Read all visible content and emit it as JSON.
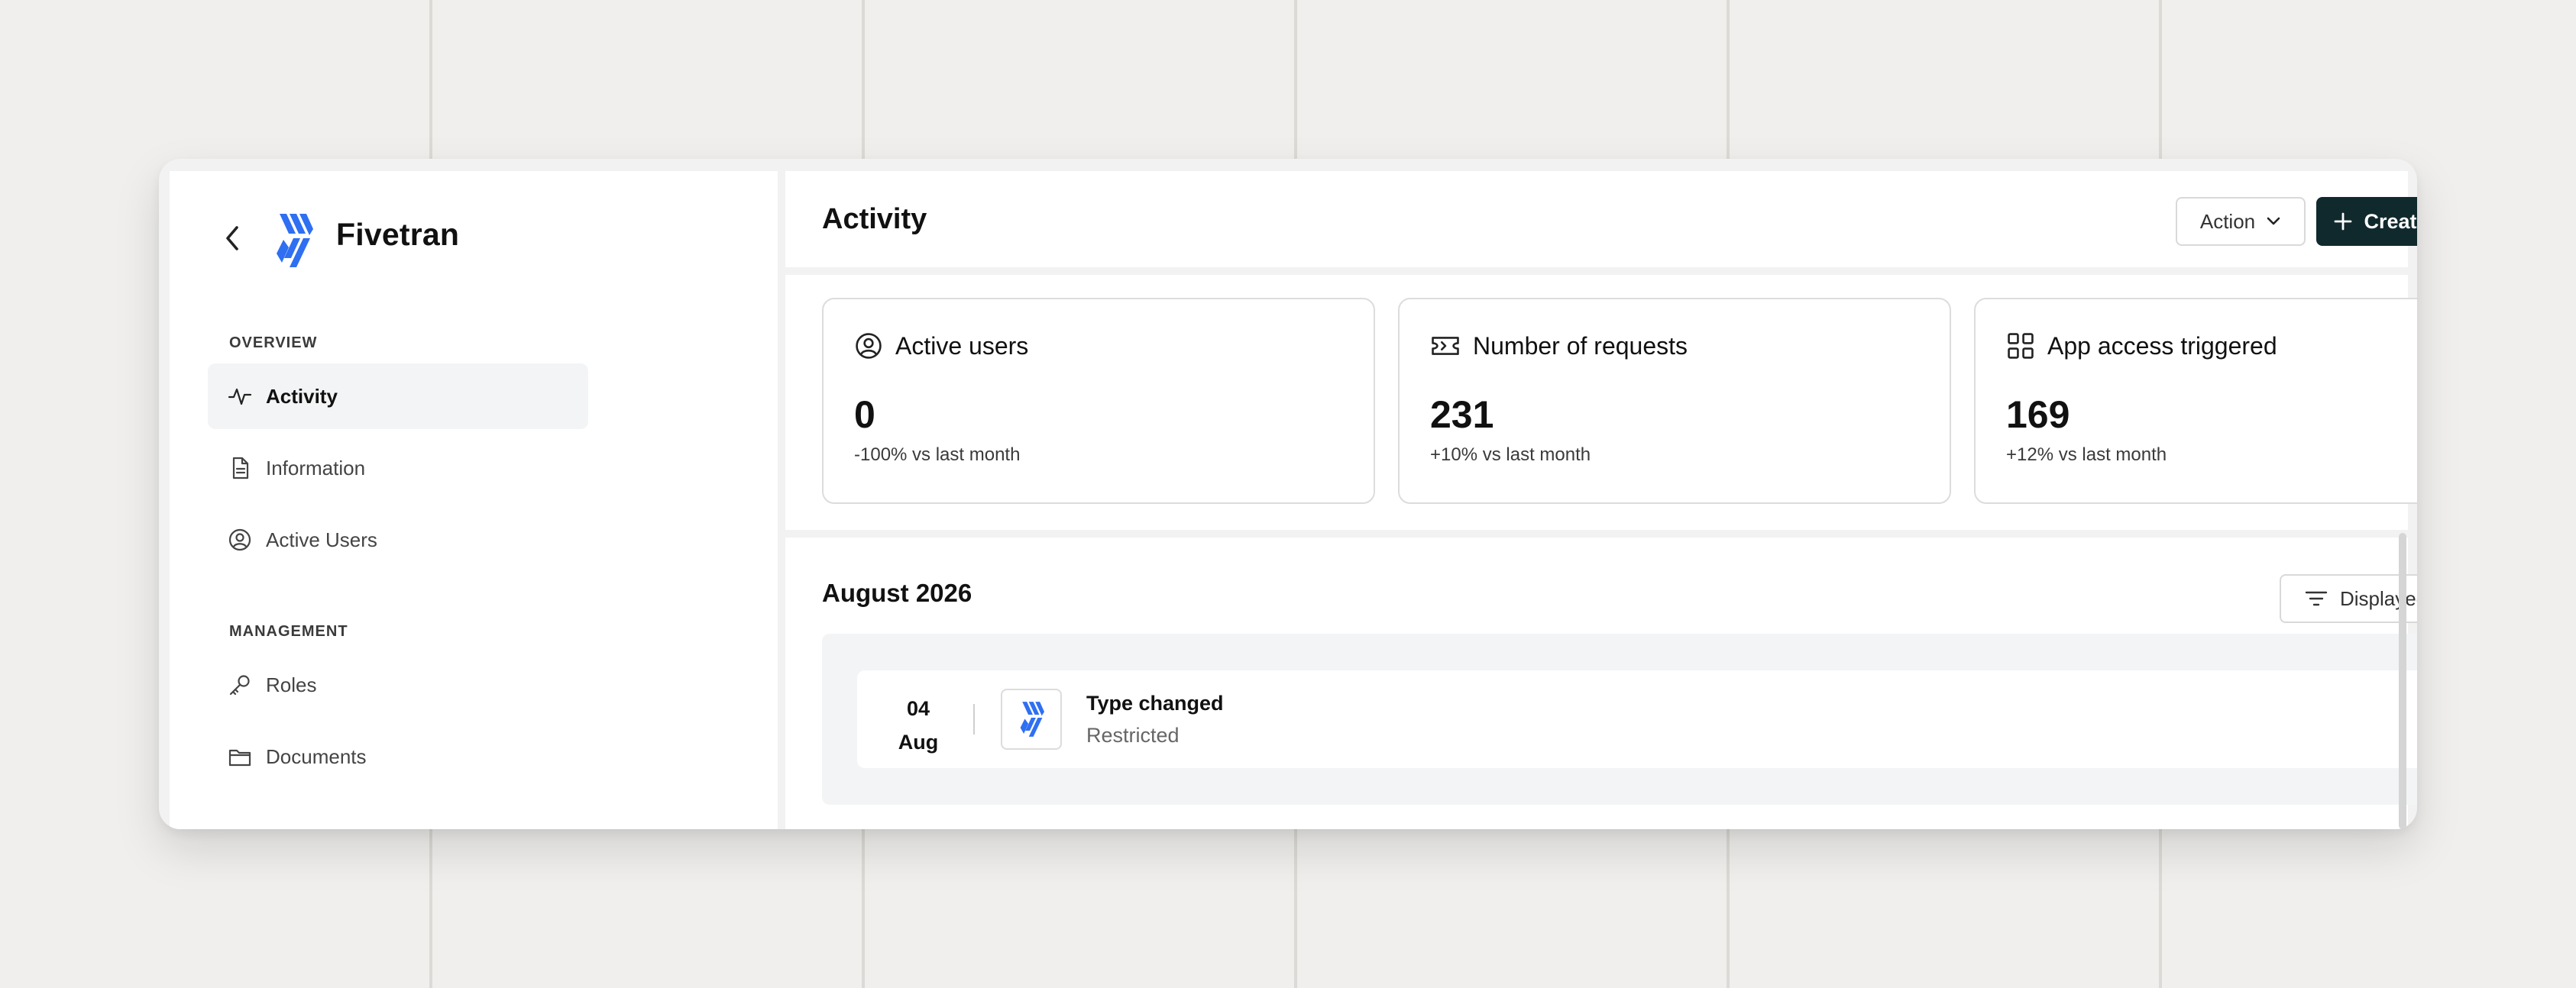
{
  "app": {
    "name": "Fivetran"
  },
  "sidebar": {
    "sections": [
      {
        "label": "OVERVIEW",
        "items": [
          {
            "label": "Activity",
            "icon": "activity-icon",
            "active": true
          },
          {
            "label": "Information",
            "icon": "document-icon",
            "active": false
          },
          {
            "label": "Active Users",
            "icon": "user-circle-icon",
            "active": false
          }
        ]
      },
      {
        "label": "MANAGEMENT",
        "items": [
          {
            "label": "Roles",
            "icon": "key-icon",
            "active": false
          },
          {
            "label": "Documents",
            "icon": "folder-icon",
            "active": false
          }
        ]
      }
    ]
  },
  "header": {
    "title": "Activity",
    "action_label": "Action",
    "create_label": "Create request"
  },
  "stats": [
    {
      "title": "Active users",
      "value": "0",
      "change": "-100% vs last month",
      "icon": "user-circle-icon"
    },
    {
      "title": "Number of requests",
      "value": "231",
      "change": "+10% vs last month",
      "icon": "ticket-icon"
    },
    {
      "title": "App access triggered",
      "value": "169",
      "change": "+12% vs last month",
      "icon": "grid-icon"
    }
  ],
  "activity": {
    "month": "August 2026",
    "filter_label": "Displayed events",
    "events": [
      {
        "day": "04",
        "month": "Aug",
        "title": "Type changed",
        "subtitle": "Restricted"
      }
    ]
  },
  "colors": {
    "brand_blue": "#2f6ff2",
    "primary_button": "#10292d",
    "page_background": "#f0efed"
  }
}
